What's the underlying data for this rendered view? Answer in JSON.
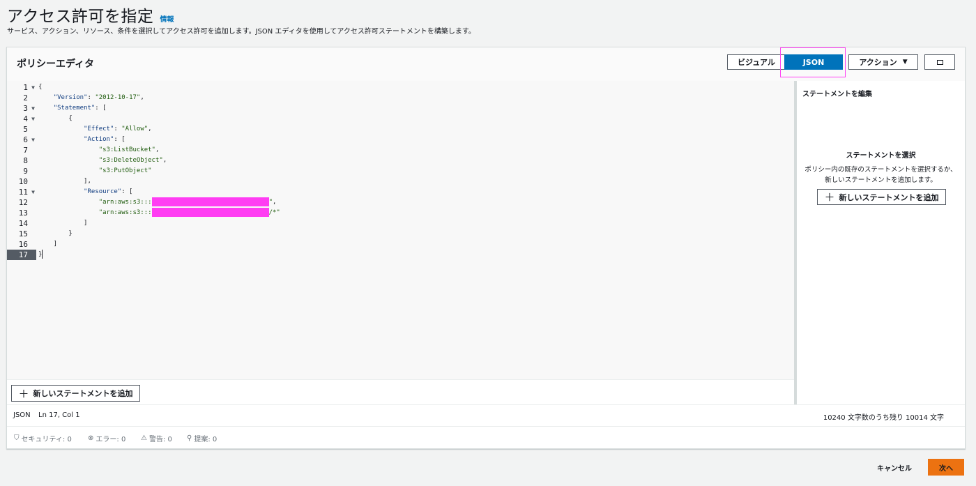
{
  "header": {
    "title": "アクセス許可を指定",
    "info_link": "情報",
    "description": "サービス、アクション、リソース、条件を選択してアクセス許可を追加します。JSON エディタを使用してアクセス許可ステートメントを構築します。"
  },
  "editor": {
    "title": "ポリシーエディタ",
    "tabs": {
      "visual": "ビジュアル",
      "json": "JSON",
      "json_selected": true
    },
    "actions_label": "アクション",
    "fullscreen_icon": "fullscreen-icon",
    "add_statement_label": "新しいステートメントを追加",
    "active_line": 17,
    "code_lines": [
      [
        {
          "t": "p",
          "v": "{"
        }
      ],
      [
        {
          "t": "p",
          "v": "    "
        },
        {
          "t": "k",
          "v": "\"Version\""
        },
        {
          "t": "p",
          "v": ": "
        },
        {
          "t": "s",
          "v": "\"2012-10-17\""
        },
        {
          "t": "p",
          "v": ","
        }
      ],
      [
        {
          "t": "p",
          "v": "    "
        },
        {
          "t": "k",
          "v": "\"Statement\""
        },
        {
          "t": "p",
          "v": ": ["
        }
      ],
      [
        {
          "t": "p",
          "v": "        {"
        }
      ],
      [
        {
          "t": "p",
          "v": "            "
        },
        {
          "t": "k",
          "v": "\"Effect\""
        },
        {
          "t": "p",
          "v": ": "
        },
        {
          "t": "s",
          "v": "\"Allow\""
        },
        {
          "t": "p",
          "v": ","
        }
      ],
      [
        {
          "t": "p",
          "v": "            "
        },
        {
          "t": "k",
          "v": "\"Action\""
        },
        {
          "t": "p",
          "v": ": ["
        }
      ],
      [
        {
          "t": "p",
          "v": "                "
        },
        {
          "t": "s",
          "v": "\"s3:ListBucket\""
        },
        {
          "t": "p",
          "v": ","
        }
      ],
      [
        {
          "t": "p",
          "v": "                "
        },
        {
          "t": "s",
          "v": "\"s3:DeleteObject\""
        },
        {
          "t": "p",
          "v": ","
        }
      ],
      [
        {
          "t": "p",
          "v": "                "
        },
        {
          "t": "s",
          "v": "\"s3:PutObject\""
        }
      ],
      [
        {
          "t": "p",
          "v": "            ],"
        }
      ],
      [
        {
          "t": "p",
          "v": "            "
        },
        {
          "t": "k",
          "v": "\"Resource\""
        },
        {
          "t": "p",
          "v": ": ["
        }
      ],
      [
        {
          "t": "p",
          "v": "                "
        },
        {
          "t": "s",
          "v": "\"arn:aws:s3:::"
        },
        {
          "t": "r",
          "v": "",
          "w": 168
        },
        {
          "t": "s",
          "v": "\""
        },
        {
          "t": "p",
          "v": ","
        }
      ],
      [
        {
          "t": "p",
          "v": "                "
        },
        {
          "t": "s",
          "v": "\"arn:aws:s3:::"
        },
        {
          "t": "r",
          "v": "",
          "w": 168
        },
        {
          "t": "s",
          "v": "/*\""
        }
      ],
      [
        {
          "t": "p",
          "v": "            ]"
        }
      ],
      [
        {
          "t": "p",
          "v": "        }"
        }
      ],
      [
        {
          "t": "p",
          "v": "    ]"
        }
      ],
      [
        {
          "t": "p",
          "v": "}"
        },
        {
          "t": "c",
          "v": ""
        }
      ]
    ],
    "fold_lines": [
      1,
      3,
      4,
      6,
      11
    ],
    "side": {
      "title": "ステートメントを編集",
      "empty_title": "ステートメントを選択",
      "empty_desc": "ポリシー内の既存のステートメントを選択するか、新しいステートメントを追加します。",
      "add_label": "新しいステートメントを追加"
    },
    "status": {
      "mode": "JSON",
      "position": "Ln 17, Col 1",
      "char_count": "10240 文字数のうち残り 10014 文字"
    },
    "validation": [
      {
        "icon": "shield-icon",
        "glyph": "⛉",
        "label": "セキュリティ: 0"
      },
      {
        "icon": "error-icon",
        "glyph": "⊗",
        "label": "エラー: 0"
      },
      {
        "icon": "warning-icon",
        "glyph": "⚠",
        "label": "警告: 0"
      },
      {
        "icon": "suggestion-icon",
        "glyph": "⚲",
        "label": "提案: 0"
      }
    ]
  },
  "footer": {
    "cancel_label": "キャンセル",
    "next_label": "次へ"
  },
  "colors": {
    "primary": "#0073bb",
    "accent": "#ec7211",
    "highlight": "#ff3df3"
  }
}
